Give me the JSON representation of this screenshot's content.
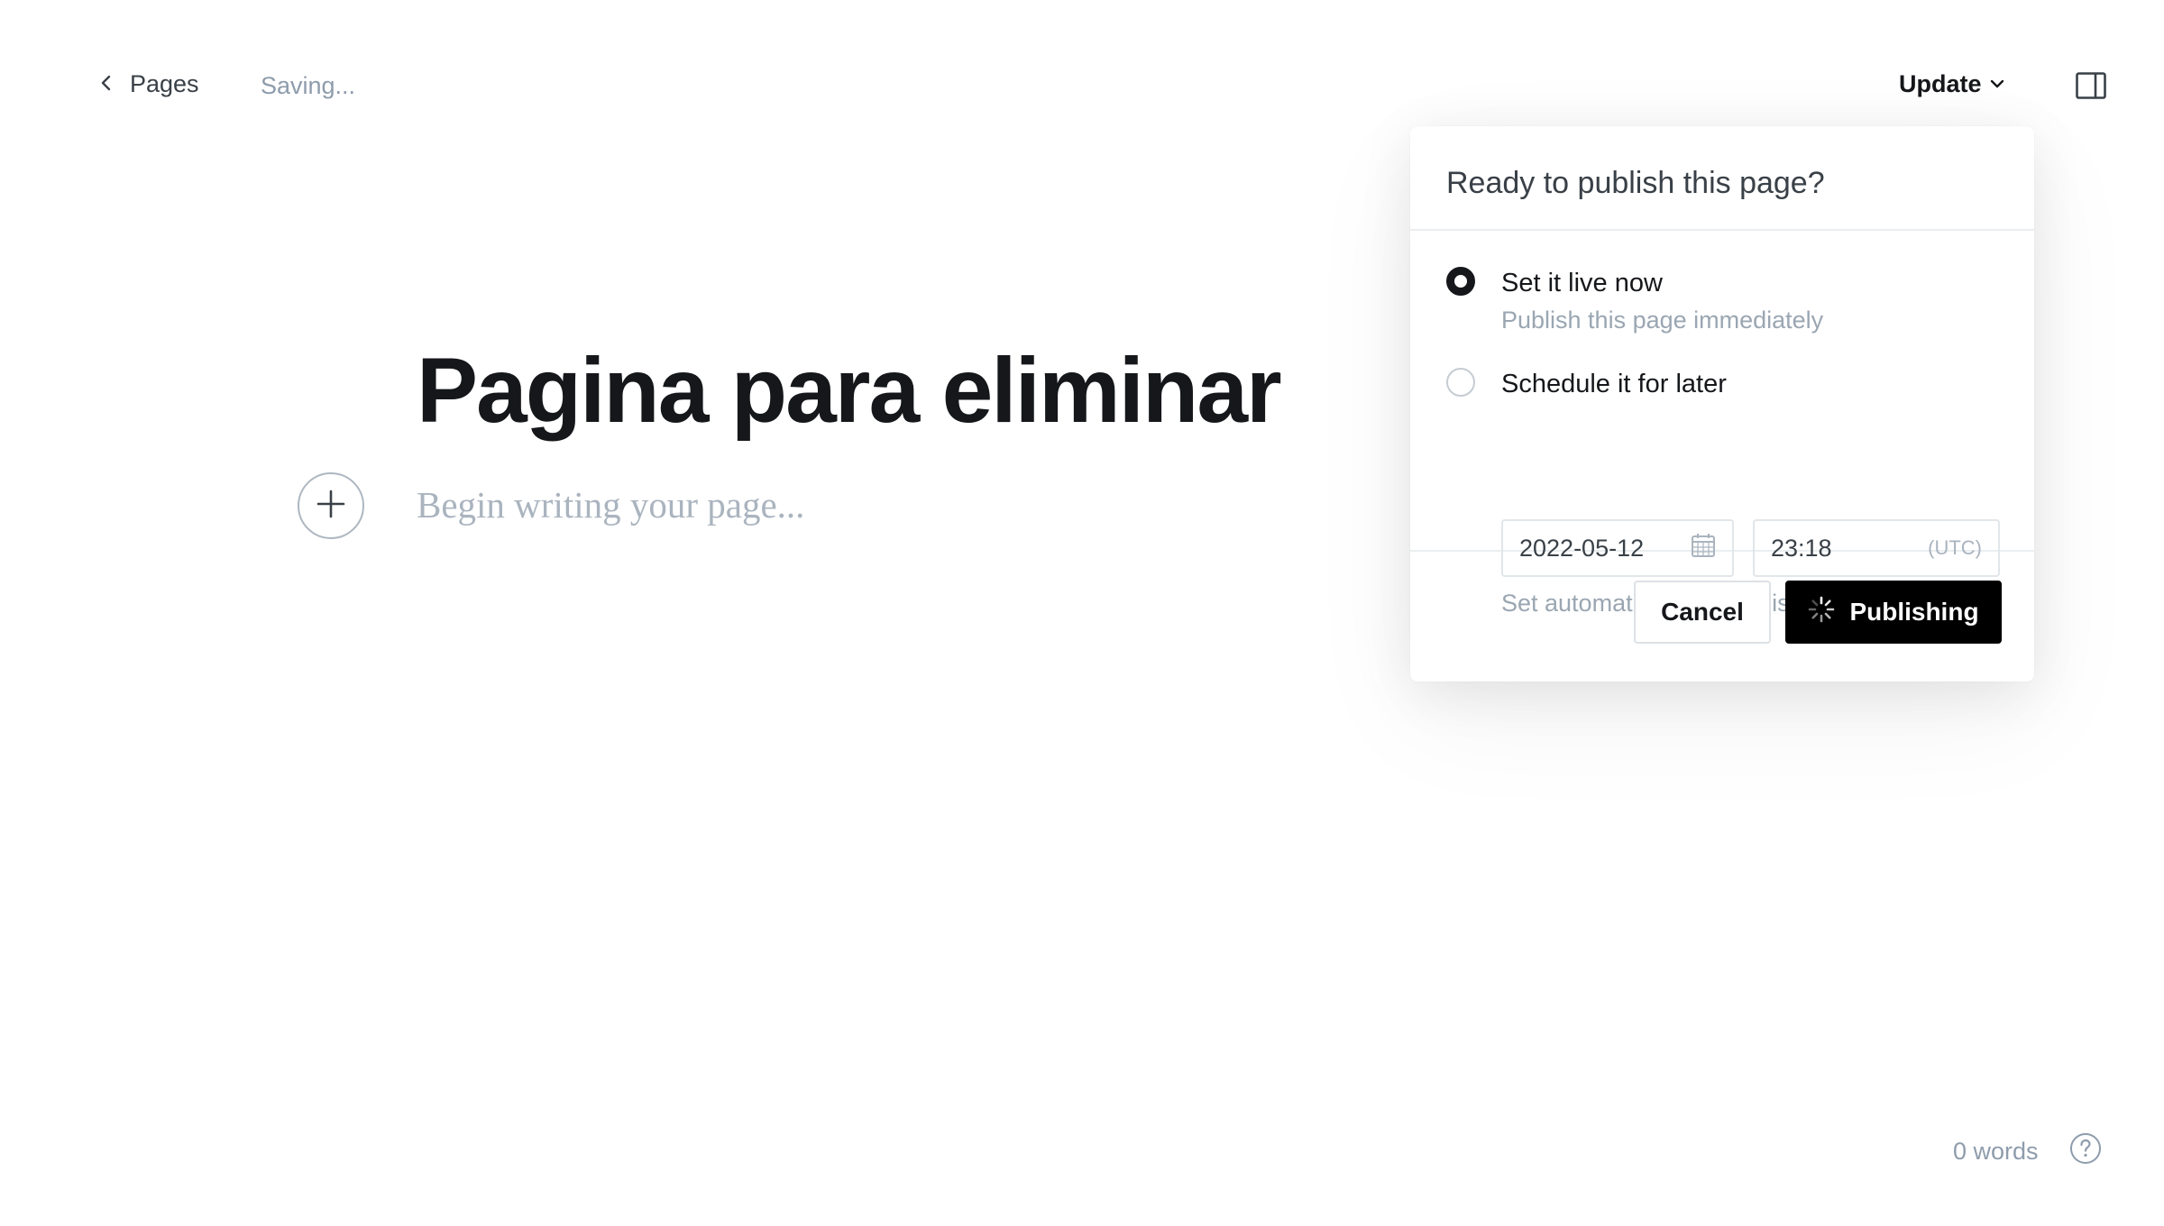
{
  "header": {
    "back_label": "Pages",
    "status": "Saving...",
    "update_label": "Update",
    "icons": {
      "back": "chevron-left-icon",
      "update": "chevron-down-icon",
      "sidebar": "sidebar-toggle-icon"
    }
  },
  "editor": {
    "title": "Pagina para eliminar",
    "body_placeholder": "Begin writing your page...",
    "add_card_icon": "plus-icon"
  },
  "publish_popover": {
    "title": "Ready to publish this page?",
    "options": [
      {
        "label": "Set it live now",
        "description": "Publish this page immediately",
        "selected": true
      },
      {
        "label": "Schedule it for later",
        "selected": false
      }
    ],
    "schedule": {
      "date": "2022-05-12",
      "time": "23:18",
      "timezone": "(UTC)",
      "hint": "Set automatic future publish date"
    },
    "cancel_label": "Cancel",
    "publish_label": "Publishing"
  },
  "footer": {
    "word_count": "0 words",
    "help_icon": "question-circle-icon"
  },
  "colors": {
    "text": "#15171a",
    "muted": "#8e9cac",
    "button_primary": "#000000",
    "border": "#e1e6ea"
  }
}
